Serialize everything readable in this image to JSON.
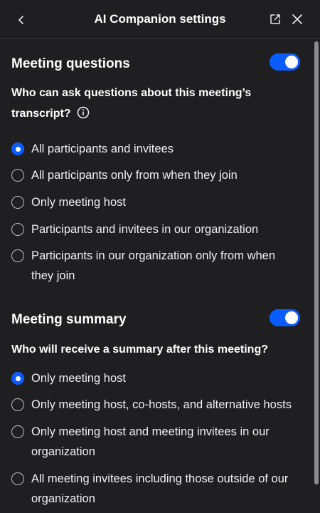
{
  "header": {
    "title": "AI Companion settings"
  },
  "icons": {
    "back": "chevron-left-icon",
    "popout": "open-external-icon",
    "close": "close-icon",
    "info": "info-icon"
  },
  "colors": {
    "background": "#1f1f22",
    "accent": "#0b5cff",
    "text": "#ffffff"
  },
  "sections": [
    {
      "title": "Meeting questions",
      "enabled": true,
      "question": "Who can ask questions about this meeting’s transcript?",
      "options": [
        {
          "label": "All participants and invitees",
          "selected": true
        },
        {
          "label": "All participants only from when they join",
          "selected": false
        },
        {
          "label": "Only meeting host",
          "selected": false
        },
        {
          "label": "Participants and invitees in our organization",
          "selected": false
        },
        {
          "label": "Participants in our organization only from when they join",
          "selected": false
        }
      ]
    },
    {
      "title": "Meeting summary",
      "enabled": true,
      "question": "Who will receive a summary after this meeting?",
      "options": [
        {
          "label": "Only meeting host",
          "selected": true
        },
        {
          "label": "Only meeting host, co-hosts, and alternative hosts",
          "selected": false
        },
        {
          "label": "Only meeting host and meeting invitees in our organization",
          "selected": false
        },
        {
          "label": "All meeting invitees including those outside of our organization",
          "selected": false
        }
      ]
    }
  ]
}
